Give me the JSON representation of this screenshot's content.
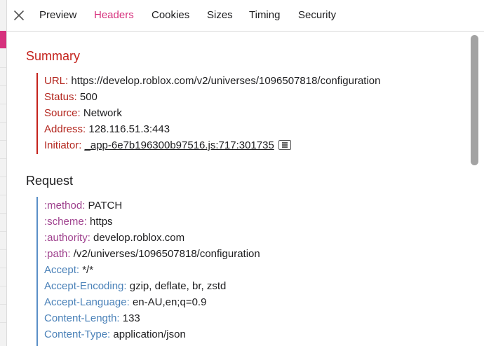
{
  "tabs": {
    "items": [
      {
        "label": "Preview"
      },
      {
        "label": "Headers",
        "active": true
      },
      {
        "label": "Cookies"
      },
      {
        "label": "Sizes"
      },
      {
        "label": "Timing"
      },
      {
        "label": "Security"
      }
    ]
  },
  "summary": {
    "title": "Summary",
    "url": {
      "key": "URL:",
      "value": "https://develop.roblox.com/v2/universes/1096507818/configuration"
    },
    "status": {
      "key": "Status:",
      "value": "500"
    },
    "source": {
      "key": "Source:",
      "value": "Network"
    },
    "address": {
      "key": "Address:",
      "value": "128.116.51.3:443"
    },
    "initiator": {
      "key": "Initiator:",
      "value": "_app-6e7b196300b97516.js:717:301735"
    }
  },
  "request": {
    "title": "Request",
    "headers": [
      {
        "key": ":method:",
        "value": "PATCH"
      },
      {
        "key": ":scheme:",
        "value": "https"
      },
      {
        "key": ":authority:",
        "value": "develop.roblox.com"
      },
      {
        "key": ":path:",
        "value": "/v2/universes/1096507818/configuration"
      },
      {
        "key": "Accept:",
        "value": "*/*"
      },
      {
        "key": "Accept-Encoding:",
        "value": "gzip, deflate, br, zstd"
      },
      {
        "key": "Accept-Language:",
        "value": "en-AU,en;q=0.9"
      },
      {
        "key": "Content-Length:",
        "value": "133"
      },
      {
        "key": "Content-Type:",
        "value": "application/json"
      }
    ]
  },
  "colors": {
    "accent": "#d6317d",
    "summary": "#c4221c",
    "pseudo_header": "#a0438f",
    "header": "#4a81b8"
  },
  "icons": {
    "close": "close-icon",
    "initiator": "reveal-in-source-icon"
  }
}
